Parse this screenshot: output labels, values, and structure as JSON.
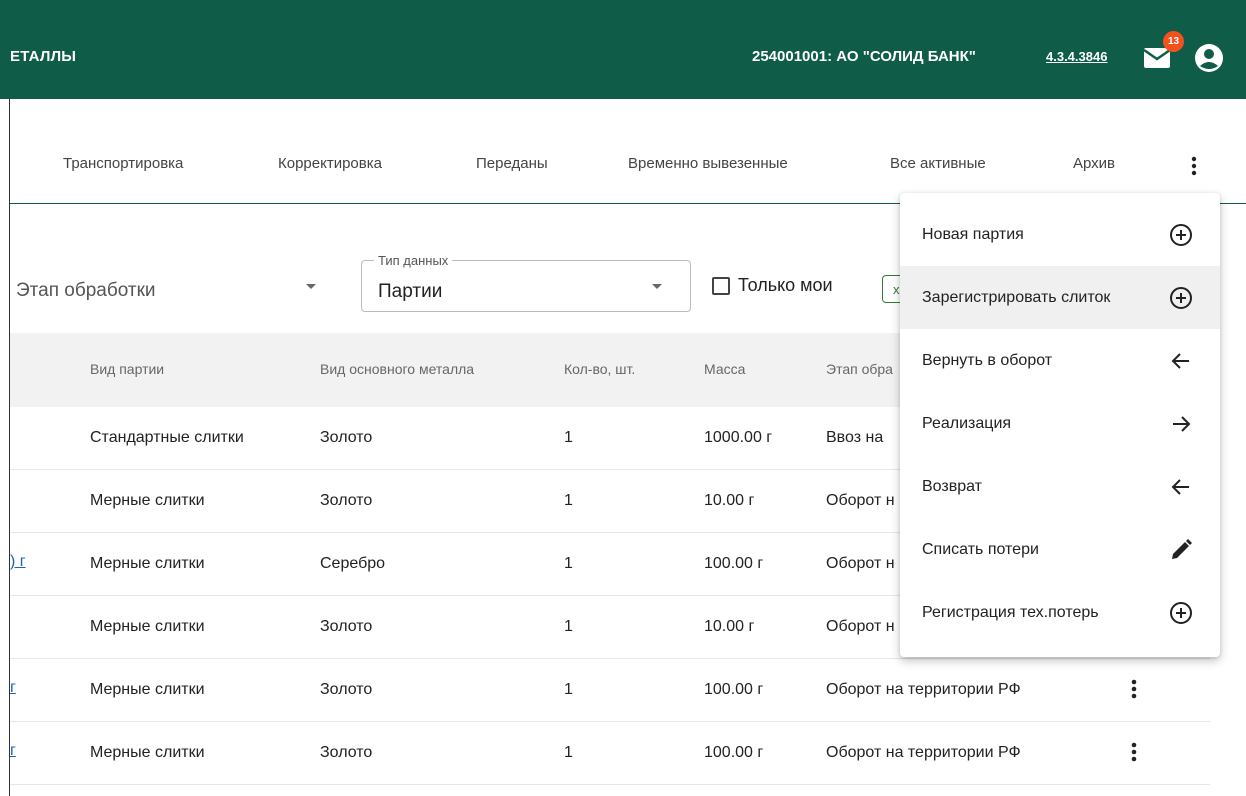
{
  "header": {
    "app_title": "ЕТАЛЛЫ",
    "organization": "254001001: АО \"СОЛИД БАНК\"",
    "version": "4.3.4.3846",
    "notifications_count": "13",
    "icons": {
      "mail": "mail-icon",
      "account": "account-circle-icon"
    }
  },
  "tabs": {
    "items": [
      "Транспортировка",
      "Корректировка",
      "Переданы",
      "Временно вывезенные",
      "Все активные",
      "Архив"
    ],
    "more_icon": "more-vertical-icon"
  },
  "filters": {
    "stage_value": "Этап обработки",
    "data_type_label": "Тип данных",
    "data_type_value": "Партии",
    "only_mine_label": "Только мои",
    "only_mine_checked": false,
    "chip_text": "х"
  },
  "table": {
    "headers": [
      "Вид партии",
      "Вид основного металла",
      "Кол-во, шт.",
      "Масса",
      "Этап обра"
    ],
    "rows": [
      {
        "link": "",
        "kind": "Стандартные слитки",
        "metal": "Золото",
        "qty": "1",
        "mass": "1000.00 г",
        "stage": "Ввоз на"
      },
      {
        "link": "",
        "kind": "Мерные слитки",
        "metal": "Золото",
        "qty": "1",
        "mass": "10.00 г",
        "stage": "Оборот н"
      },
      {
        "link": ") г",
        "kind": "Мерные слитки",
        "metal": "Серебро",
        "qty": "1",
        "mass": "100.00 г",
        "stage": "Оборот н"
      },
      {
        "link": "",
        "kind": "Мерные слитки",
        "metal": "Золото",
        "qty": "1",
        "mass": "10.00 г",
        "stage": "Оборот н"
      },
      {
        "link": "г",
        "kind": "Мерные слитки",
        "metal": "Золото",
        "qty": "1",
        "mass": "100.00 г",
        "stage": "Оборот на территории РФ"
      },
      {
        "link": "г",
        "kind": "Мерные слитки",
        "metal": "Золото",
        "qty": "1",
        "mass": "100.00 г",
        "stage": "Оборот на территории РФ"
      }
    ]
  },
  "menu": {
    "items": [
      {
        "label": "Новая партия",
        "icon": "add-circle-icon"
      },
      {
        "label": "Зарегистрировать слиток",
        "icon": "add-circle-icon",
        "highlighted": true
      },
      {
        "label": "Вернуть в оборот",
        "icon": "arrow-left-icon"
      },
      {
        "label": "Реализация",
        "icon": "arrow-right-icon"
      },
      {
        "label": "Возврат",
        "icon": "arrow-left-icon"
      },
      {
        "label": "Списать потери",
        "icon": "pencil-icon"
      },
      {
        "label": "Регистрация тех.потерь",
        "icon": "add-circle-icon"
      }
    ]
  },
  "colors": {
    "header_bg": "#0f5c49",
    "badge": "#f4511e",
    "link": "#1565c0"
  }
}
